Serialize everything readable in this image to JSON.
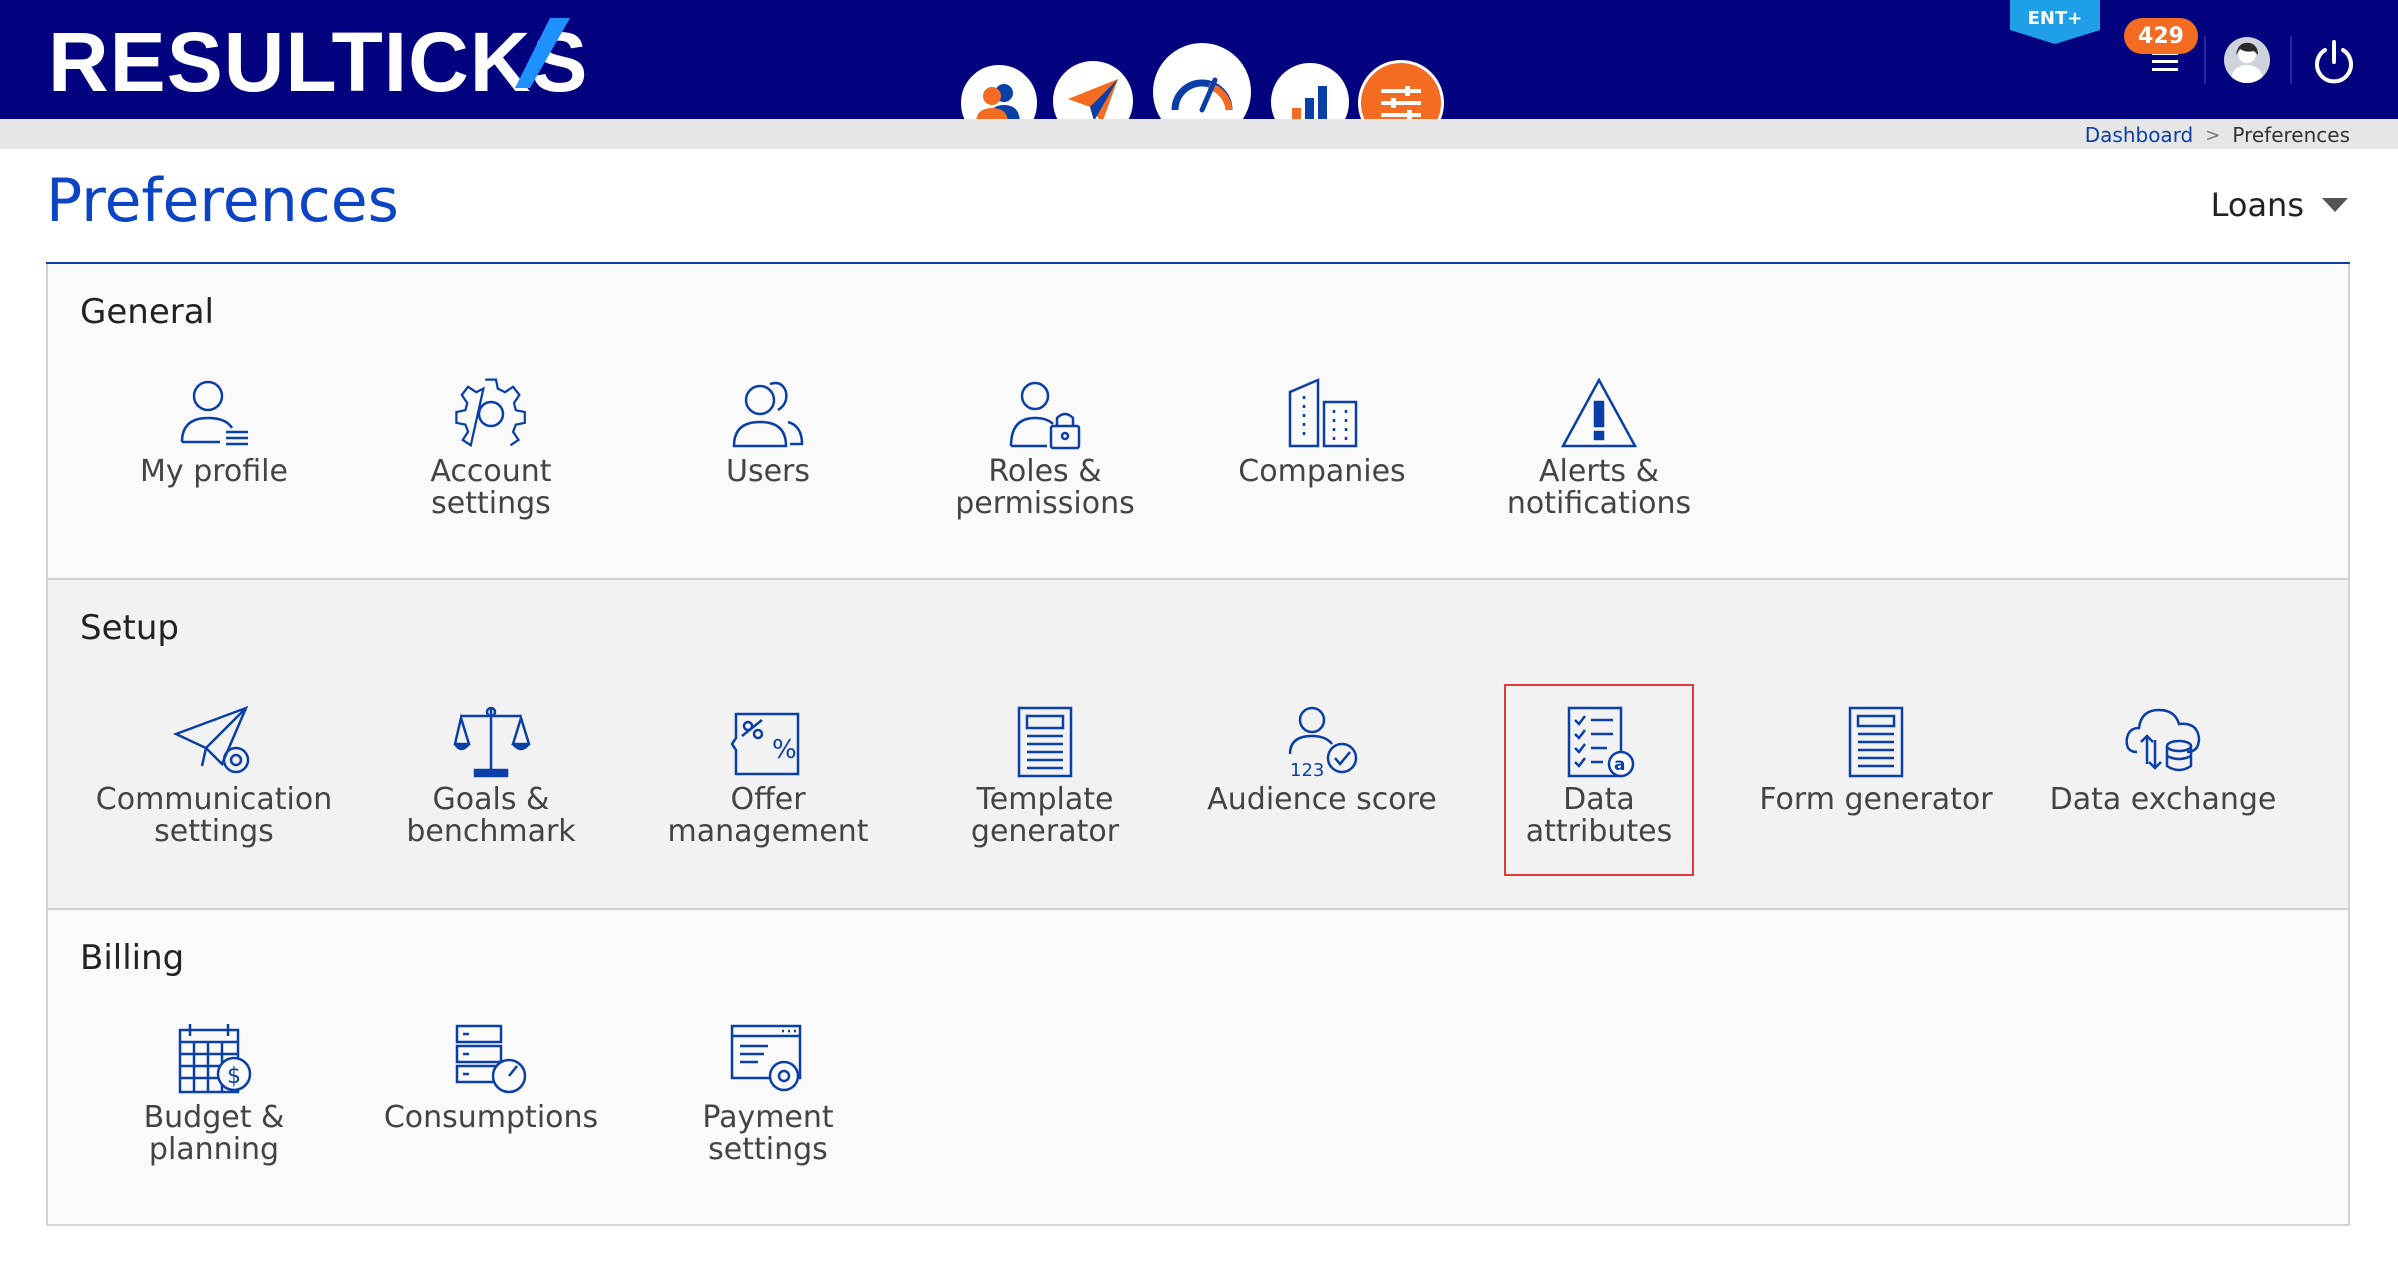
{
  "header": {
    "logo_text": "RESULTICKS",
    "plan_badge": "ENT+",
    "notification_count": "429",
    "nav": [
      {
        "name": "audience-icon"
      },
      {
        "name": "communication-icon"
      },
      {
        "name": "analytics-gauge-icon"
      },
      {
        "name": "reports-icon"
      },
      {
        "name": "preferences-icon",
        "active": true
      }
    ]
  },
  "breadcrumb": {
    "home": "Dashboard",
    "separator": ">",
    "current": "Preferences"
  },
  "page": {
    "title": "Preferences",
    "business_unit": "Loans"
  },
  "sections": {
    "general": {
      "title": "General",
      "items": [
        "My profile",
        "Account settings",
        "Users",
        "Roles & permissions",
        "Companies",
        "Alerts & notifications"
      ]
    },
    "setup": {
      "title": "Setup",
      "items": [
        "Communication settings",
        "Goals & benchmark",
        "Offer management",
        "Template generator",
        "Audience score",
        "Data attributes",
        "Form generator",
        "Data exchange"
      ],
      "selected": "Data attributes"
    },
    "billing": {
      "title": "Billing",
      "items": [
        "Budget & planning",
        "Consumptions",
        "Payment settings"
      ]
    }
  },
  "colors": {
    "header_bg": "#04037f",
    "accent_orange": "#f36c21",
    "title_blue": "#0b44c4",
    "icon_blue": "#0b3fa8",
    "selected_border": "#e23a3a"
  }
}
